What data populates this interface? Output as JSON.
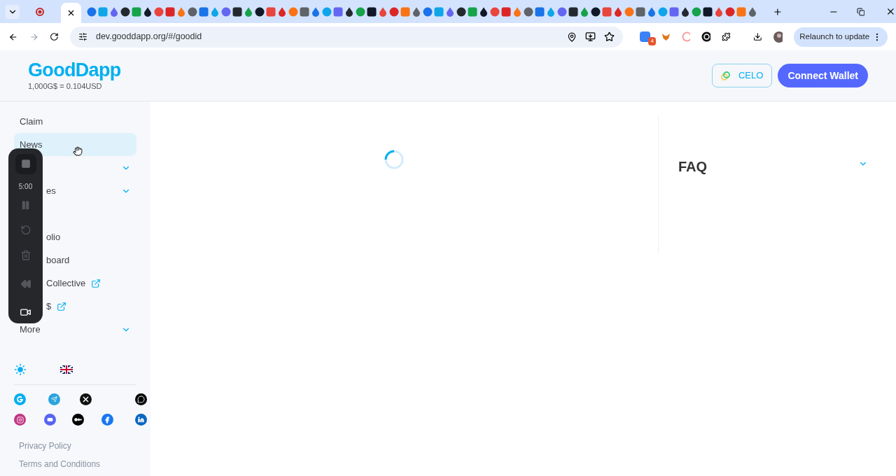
{
  "browser": {
    "url": "dev.gooddapp.org/#/goodid",
    "extension_badge": "4",
    "relaunch_button": "Relaunch to update"
  },
  "header": {
    "logo": "GoodDapp",
    "rate": "1,000G$ = 0.104USD",
    "network_button": "CELO",
    "connect_button": "Connect Wallet"
  },
  "sidebar": {
    "items": [
      {
        "kind": "link",
        "label": "Claim",
        "selected": false
      },
      {
        "kind": "link",
        "label": "News",
        "selected": true
      },
      {
        "kind": "dropdown",
        "selected": false
      },
      {
        "kind": "dropdown",
        "label": "es",
        "selected": false
      },
      {
        "kind": "link",
        "selected": false
      },
      {
        "kind": "link",
        "label": "olio",
        "selected": false
      },
      {
        "kind": "link",
        "label": "board",
        "selected": false
      },
      {
        "kind": "external",
        "label": "Collective",
        "selected": false
      },
      {
        "kind": "external",
        "label": "$",
        "selected": false
      },
      {
        "kind": "dropdown",
        "label": "More",
        "selected": false
      }
    ],
    "footer_links": [
      "Privacy Policy",
      "Terms and Conditions"
    ]
  },
  "recorder": {
    "timer": "5:00"
  },
  "faq": {
    "title": "FAQ",
    "expanded": false
  }
}
